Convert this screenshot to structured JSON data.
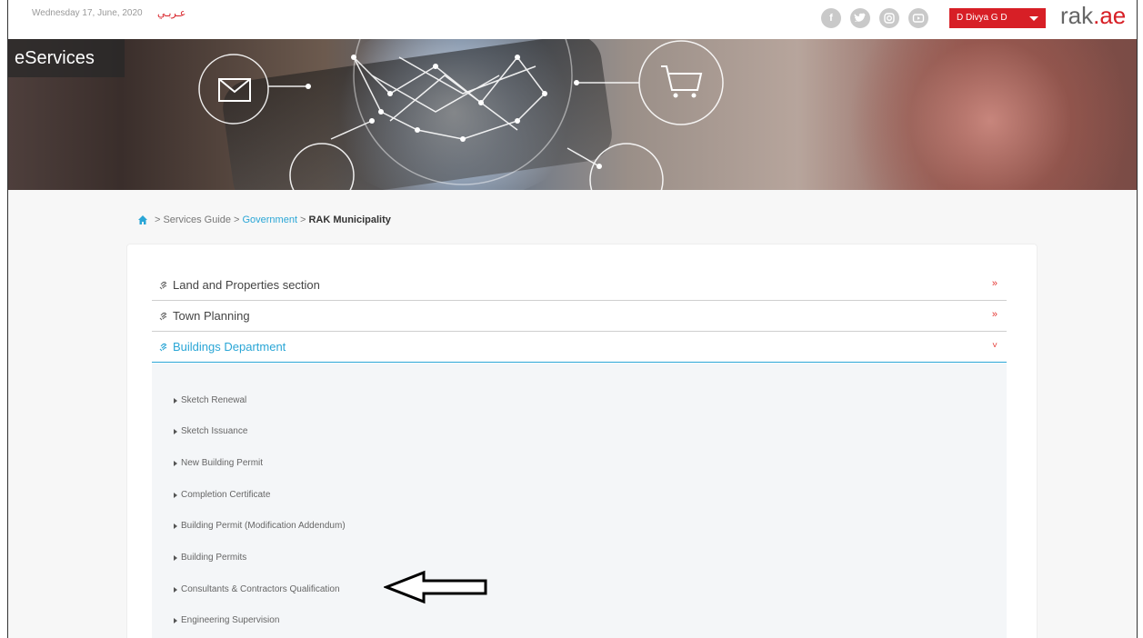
{
  "topbar": {
    "date": "Wednesday 17, June, 2020",
    "language_link": "عـربـي",
    "social_icons": [
      "facebook-icon",
      "twitter-icon",
      "instagram-icon",
      "youtube-icon"
    ],
    "user_name": "D Divya G D",
    "logo_main": "rak",
    "logo_suffix": ".ae"
  },
  "banner": {
    "title": "eServices"
  },
  "breadcrumb": {
    "home_icon": "home-icon",
    "items": [
      "Services Guide",
      "Government",
      "RAK Municipality"
    ]
  },
  "accordion": {
    "sections": [
      {
        "label": "Land and Properties section",
        "chevron": "»"
      },
      {
        "label": "Town Planning",
        "chevron": "»"
      },
      {
        "label": "Buildings Department",
        "chevron": "˅"
      }
    ],
    "services": [
      "Sketch Renewal",
      "Sketch Issuance",
      "New Building Permit",
      "Completion Certificate",
      "Building Permit (Modification Addendum)",
      "Building Permits",
      "Consultants & Contractors Qualification",
      "Engineering Supervision"
    ]
  },
  "colors": {
    "accent": "#2aa6d6",
    "brand_red": "#d71f26"
  }
}
